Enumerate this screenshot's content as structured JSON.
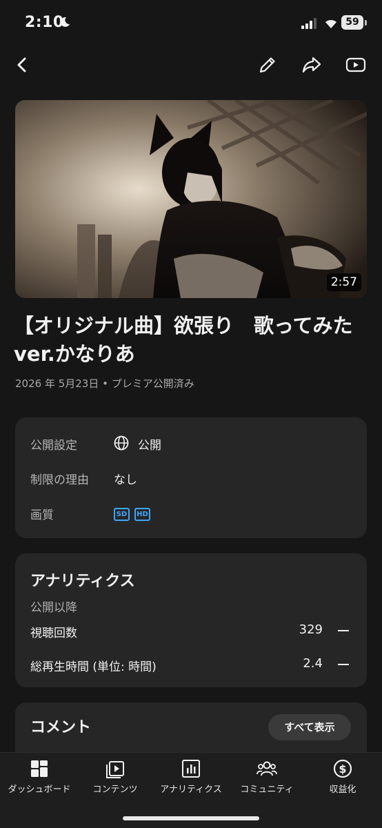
{
  "status_bar": {
    "time": "2:10",
    "battery": "59"
  },
  "video": {
    "duration": "2:57",
    "title": "【オリジナル曲】欲張り　歌ってみた　ver.かなりあ",
    "meta": "2026 年 5月23日 • プレミア公開済み"
  },
  "info": {
    "visibility_label": "公開設定",
    "visibility_value": "公開",
    "restriction_label": "制限の理由",
    "restriction_value": "なし",
    "quality_label": "画質",
    "quality_badges": [
      "SD",
      "HD"
    ]
  },
  "analytics": {
    "title": "アナリティクス",
    "subtitle": "公開以降",
    "views_label": "視聴回数",
    "views_value": "329",
    "watch_time_label": "総再生時間 (単位: 時間)",
    "watch_time_value": "2.4"
  },
  "comments": {
    "title": "コメント",
    "show_all": "すべて表示"
  },
  "nav": [
    {
      "label": "ダッシュボード",
      "icon": "dashboard-icon"
    },
    {
      "label": "コンテンツ",
      "icon": "content-icon"
    },
    {
      "label": "アナリティクス",
      "icon": "analytics-icon"
    },
    {
      "label": "コミュニティ",
      "icon": "community-icon"
    },
    {
      "label": "収益化",
      "icon": "monetization-icon"
    }
  ],
  "colors": {
    "background": "#161616",
    "card": "#262626",
    "accent_blue": "#3ea6ff"
  }
}
